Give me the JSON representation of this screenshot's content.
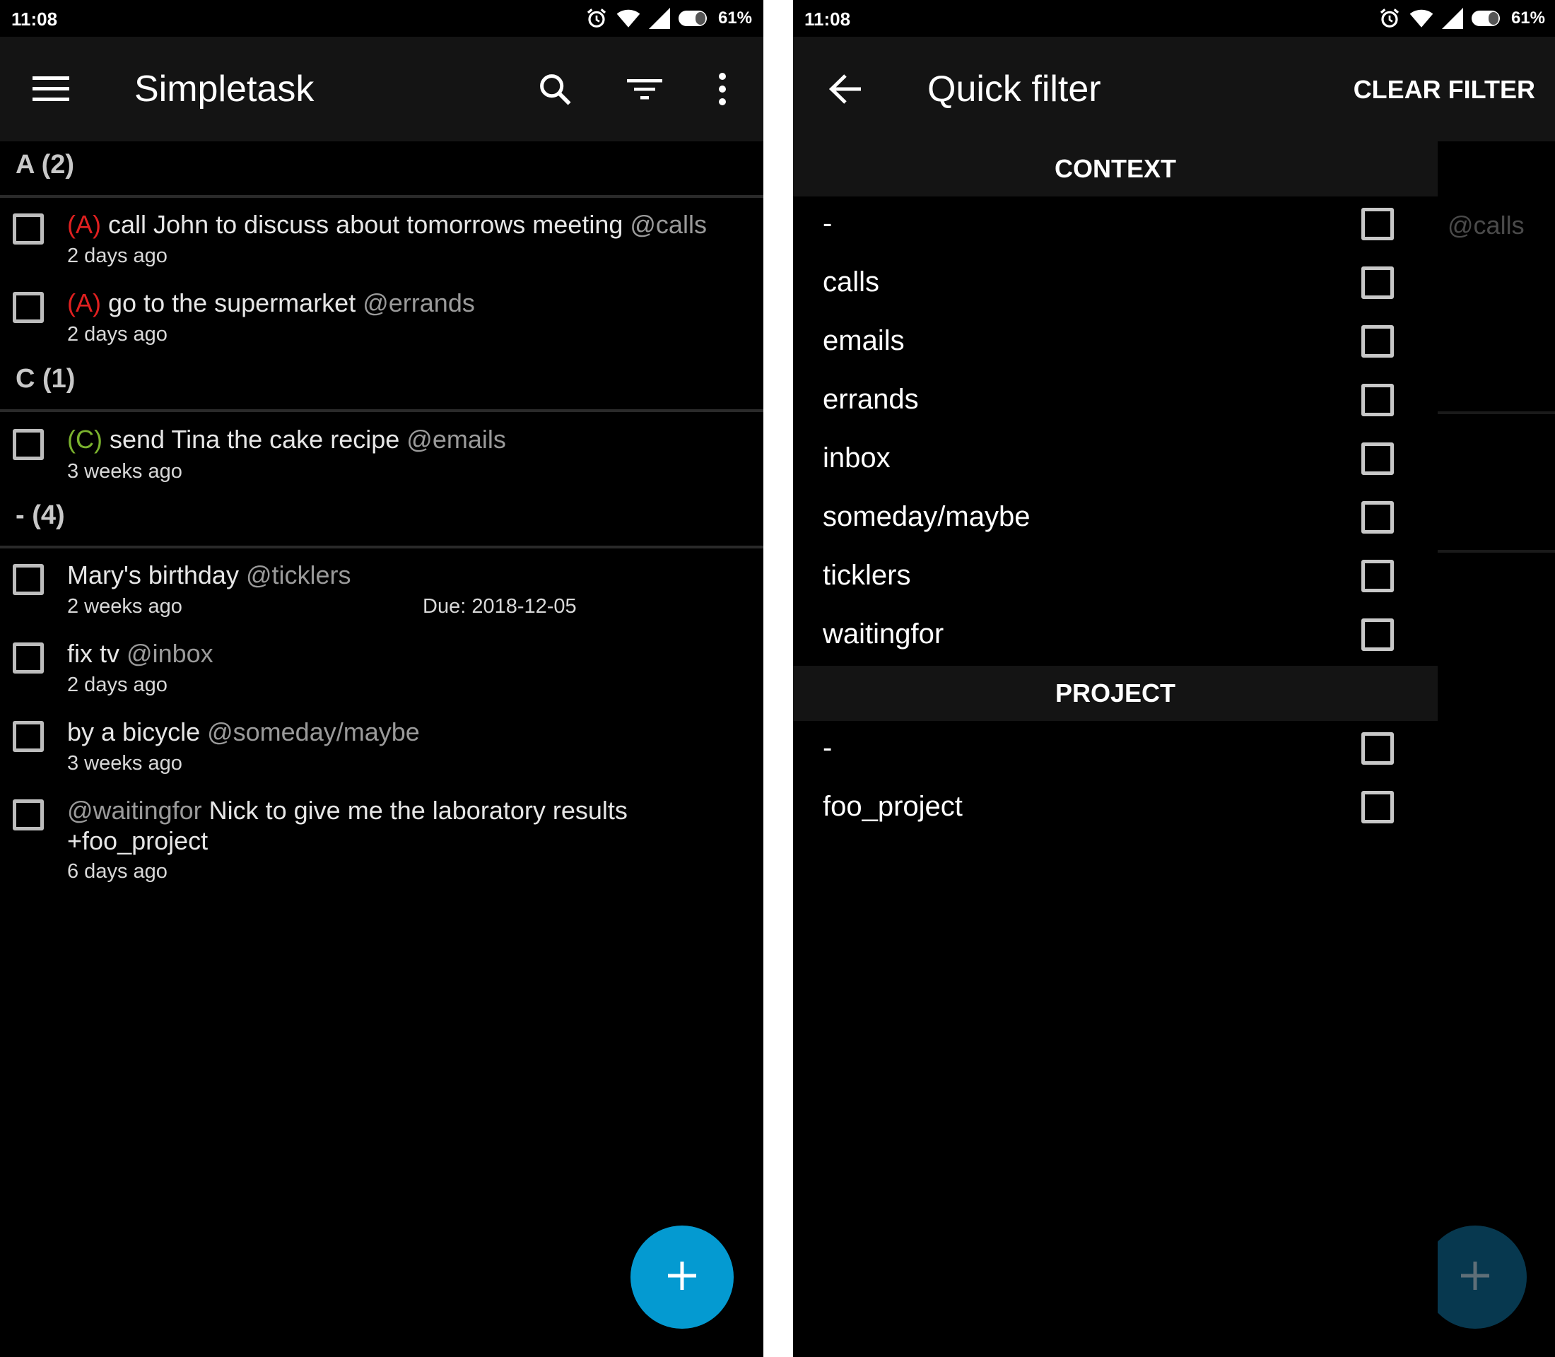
{
  "status_bar": {
    "time": "11:08",
    "battery": "61%"
  },
  "left_screen": {
    "app_title": "Simpletask",
    "icons": [
      "menu-icon",
      "search-icon",
      "filter-icon",
      "more-vert-icon"
    ],
    "groups": [
      {
        "header": "A (2)",
        "tasks": [
          {
            "priority": "(A)",
            "text": "call John to discuss about tomorrows meeting",
            "tag": "@calls",
            "age": "2 days ago"
          },
          {
            "priority": "(A)",
            "text": "go to the supermarket",
            "tag": "@errands",
            "age": "2 days ago"
          }
        ]
      },
      {
        "header": "C (1)",
        "tasks": [
          {
            "priority": "(C)",
            "text": "send Tina the cake recipe",
            "tag": "@emails",
            "age": "3 weeks ago"
          }
        ]
      },
      {
        "header": "- (4)",
        "tasks": [
          {
            "text": "Mary's birthday",
            "tag": "@ticklers",
            "age": "2 weeks ago",
            "due": "Due: 2018-12-05"
          },
          {
            "text": "fix tv",
            "tag": "@inbox",
            "age": "2 days ago"
          },
          {
            "text": "by a bicycle",
            "tag": "@someday/maybe",
            "age": "3 weeks ago"
          },
          {
            "lead_tag": "@waitingfor",
            "text": "Nick to give me the laboratory results",
            "line2_tag": "+foo_project",
            "age": "6 days ago"
          }
        ]
      }
    ],
    "fab_icon": "plus-icon"
  },
  "right_screen": {
    "title": "Quick filter",
    "action": "CLEAR FILTER",
    "context_header": "CONTEXT",
    "contexts": [
      "-",
      "calls",
      "emails",
      "errands",
      "inbox",
      "someday/maybe",
      "ticklers",
      "waitingfor"
    ],
    "project_header": "PROJECT",
    "projects": [
      "-",
      "foo_project"
    ],
    "background_peek": "@calls"
  },
  "colors": {
    "background": "#000000",
    "appbar": "#141414",
    "priority_a": "#e02020",
    "priority_c": "#7bb32e",
    "tag": "#9a9a9a",
    "fab": "#049ad1"
  }
}
